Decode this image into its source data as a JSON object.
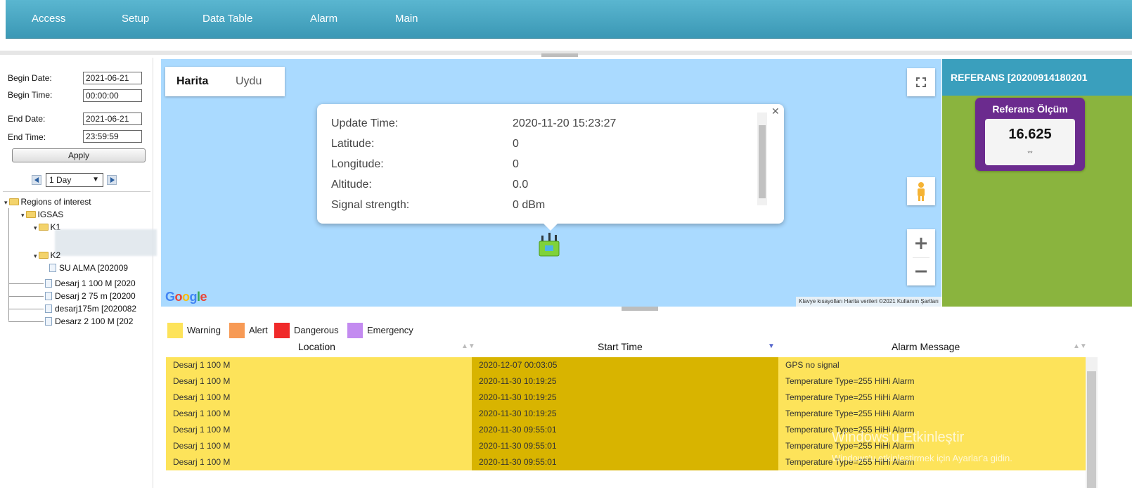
{
  "nav": {
    "items": [
      "Access",
      "Setup",
      "Data Table",
      "Alarm",
      "Main"
    ]
  },
  "filters": {
    "begin_date_label": "Begin Date:",
    "begin_date_value": "2021-06-21",
    "begin_time_label": "Begin Time:",
    "begin_time_value": "00:00:00",
    "end_date_label": "End Date:",
    "end_date_value": "2021-06-21",
    "end_time_label": "End Time:",
    "end_time_value": "23:59:59",
    "apply_label": "Apply",
    "period_value": "1 Day"
  },
  "tree": {
    "root": "Regions of interest",
    "group": "IGSAS",
    "k1": "K1",
    "k2": "K2",
    "su_alma": "SU ALMA [202009",
    "desarj1": "Desarj 1 100 M [2020",
    "desarj2": "Desarj 2 75 m [20200",
    "desarj175": "desarj175m [2020082",
    "desarz2": "Desarz 2 100 M [202"
  },
  "map": {
    "tab_map": "Harita",
    "tab_satellite": "Uydu",
    "google": "Google",
    "attribution": "Klavye kısayolları   Harita verileri ©2021   Kullanım Şartları",
    "popup": {
      "rows": [
        {
          "label": "Update Time:",
          "value": "2020-11-20 15:23:27"
        },
        {
          "label": "Latitude:",
          "value": "0"
        },
        {
          "label": "Longitude:",
          "value": "0"
        },
        {
          "label": "Altitude:",
          "value": "0.0"
        },
        {
          "label": "Signal strength:",
          "value": "0 dBm"
        }
      ]
    }
  },
  "right_panel": {
    "header": "REFERANS [20200914180201",
    "gauge_title": "Referans Ölçüm",
    "gauge_value": "16.625",
    "gauge_unit": "**"
  },
  "legend": {
    "items": [
      {
        "label": "Warning",
        "color": "#fde35a"
      },
      {
        "label": "Alert",
        "color": "#f79a55"
      },
      {
        "label": "Dangerous",
        "color": "#f02a2a"
      },
      {
        "label": "Emergency",
        "color": "#c38bf0"
      }
    ]
  },
  "table": {
    "headers": [
      "Location",
      "Start Time",
      "Alarm Message"
    ],
    "rows": [
      [
        "Desarj 1 100 M",
        "2020-12-07 00:03:05",
        "GPS no signal"
      ],
      [
        "Desarj 1 100 M",
        "2020-11-30 10:19:25",
        "Temperature Type=255 HiHi Alarm"
      ],
      [
        "Desarj 1 100 M",
        "2020-11-30 10:19:25",
        "Temperature Type=255 HiHi Alarm"
      ],
      [
        "Desarj 1 100 M",
        "2020-11-30 10:19:25",
        "Temperature Type=255 HiHi Alarm"
      ],
      [
        "Desarj 1 100 M",
        "2020-11-30 09:55:01",
        "Temperature Type=255 HiHi Alarm"
      ],
      [
        "Desarj 1 100 M",
        "2020-11-30 09:55:01",
        "Temperature Type=255 HiHi Alarm"
      ],
      [
        "Desarj 1 100 M",
        "2020-11-30 09:55:01",
        "Temperature Type=255 HiHi Alarm"
      ]
    ]
  },
  "watermark": {
    "line1": "Windows'u Etkinleştir",
    "line2": "Windows'u etkinleştirmek için Ayarlar'a gidin."
  }
}
